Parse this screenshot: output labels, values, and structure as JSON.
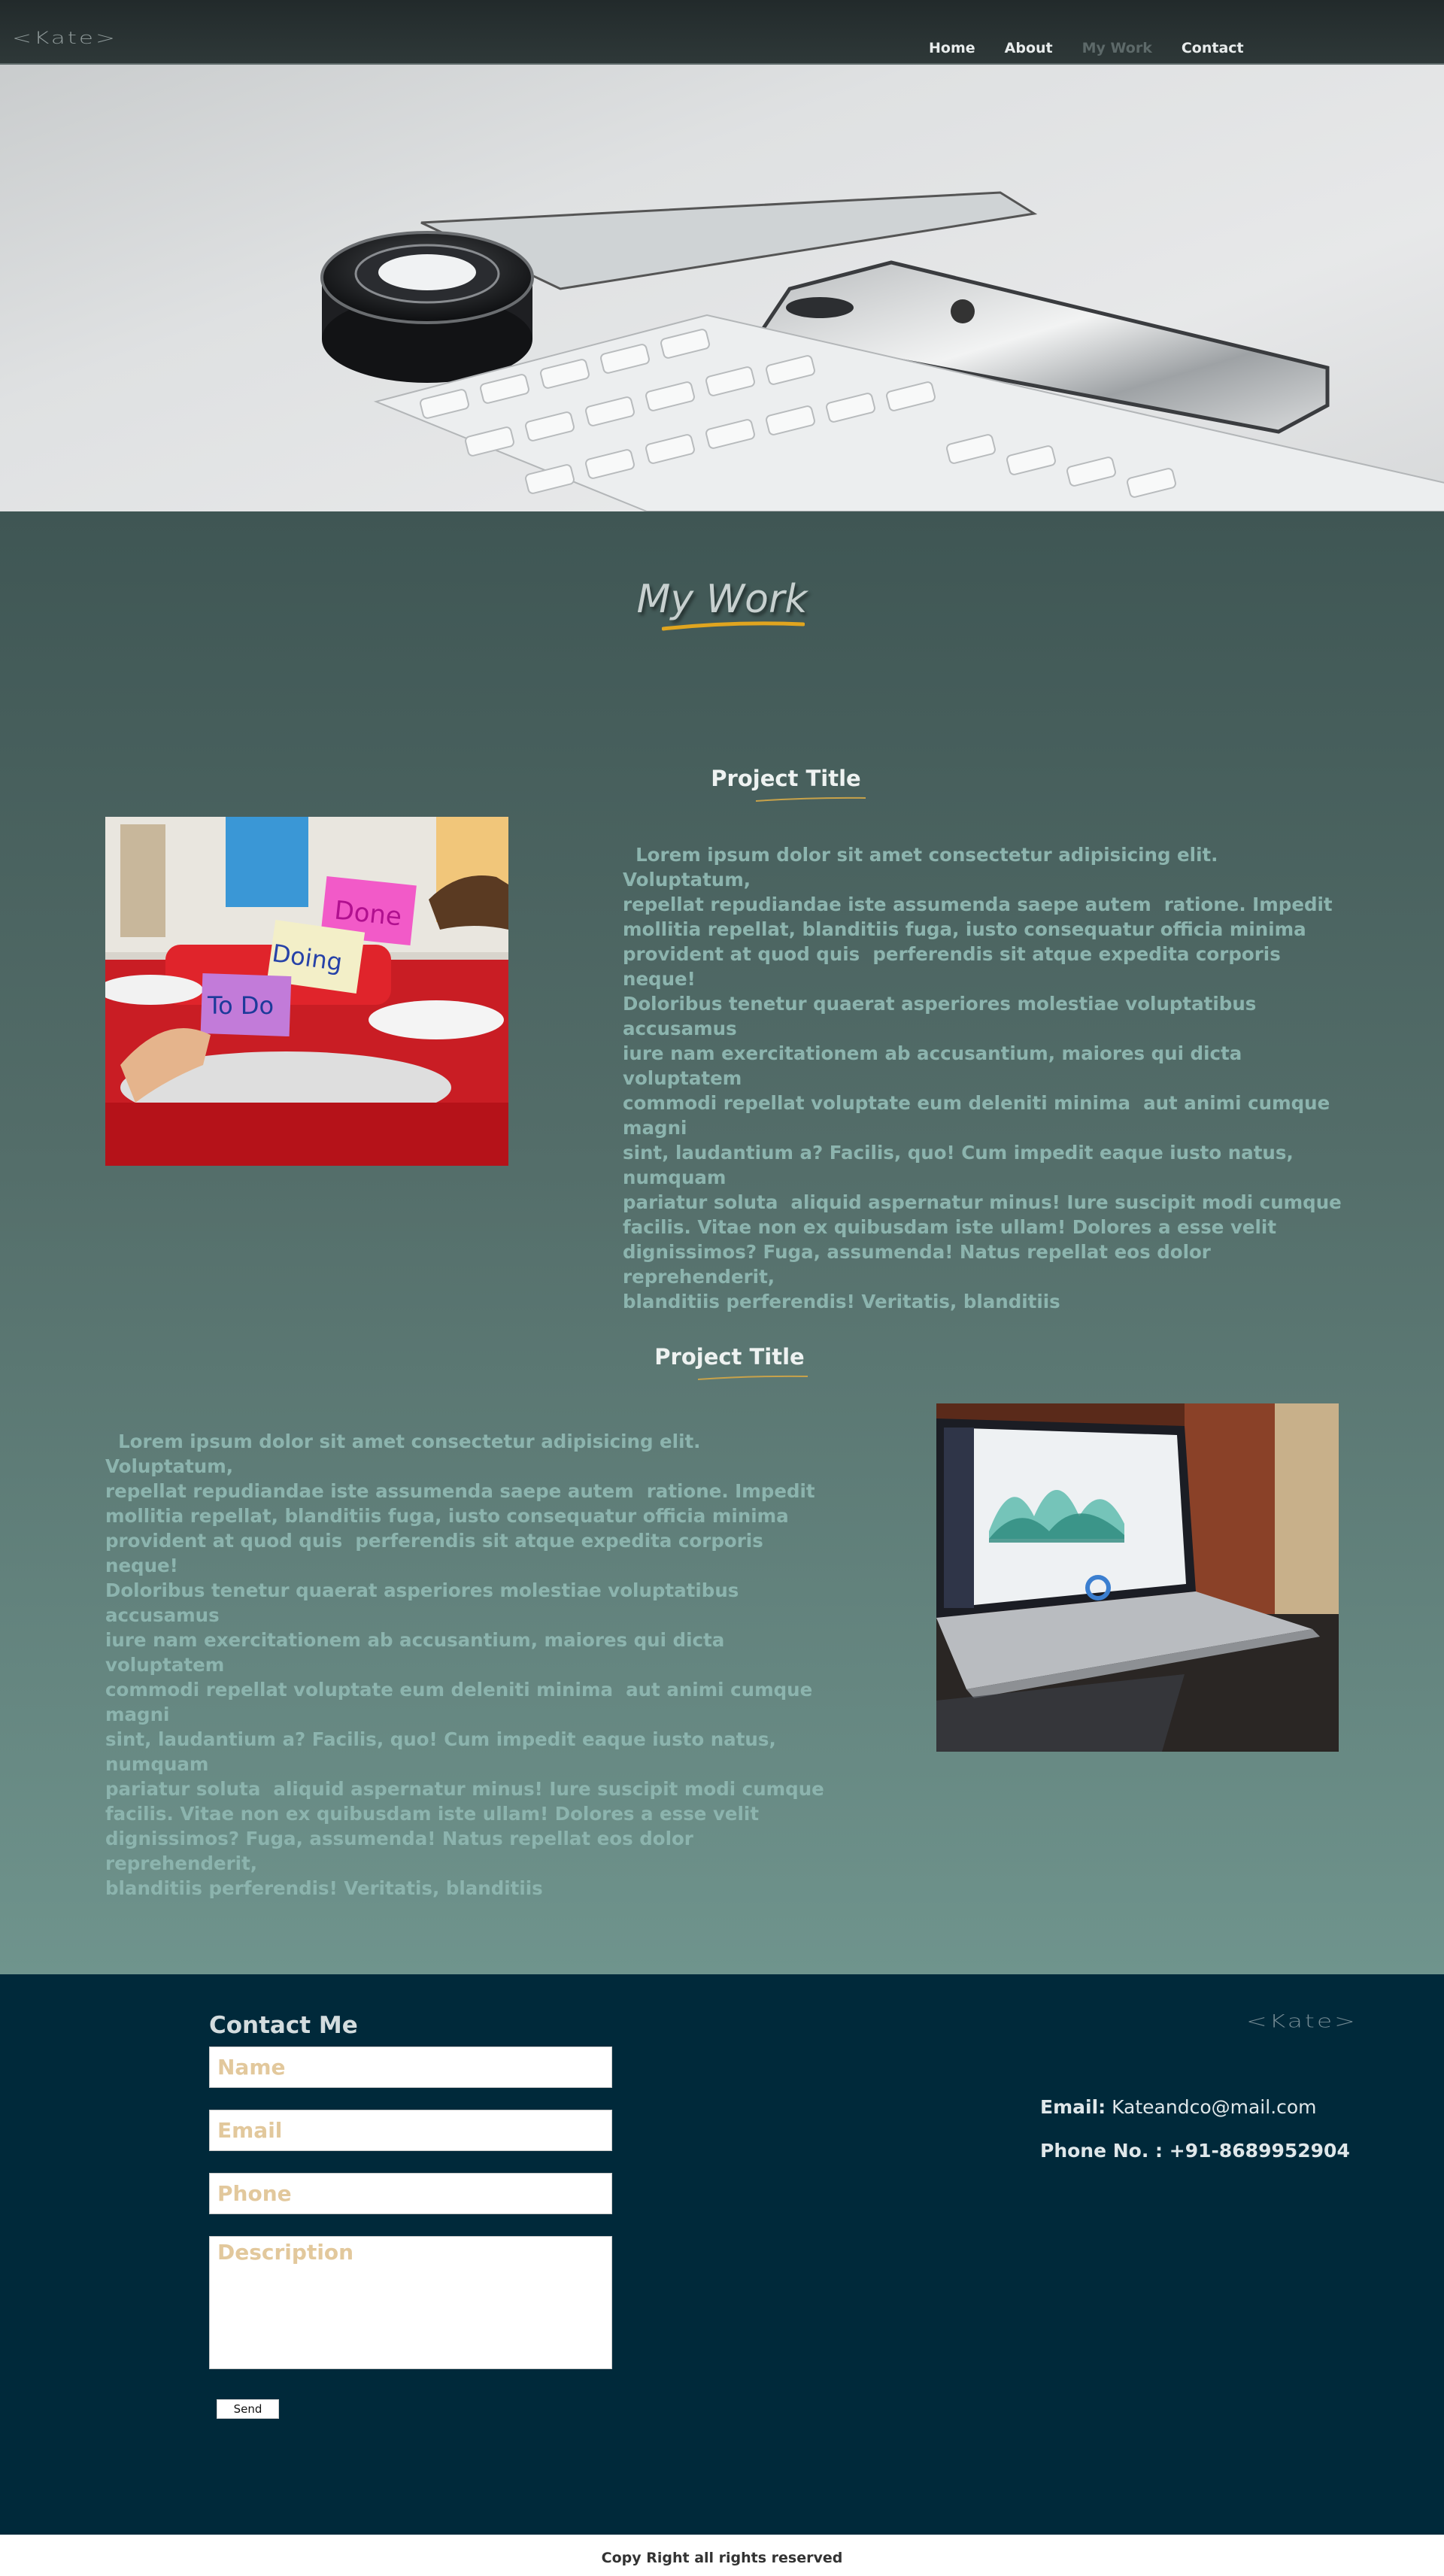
{
  "brand": {
    "logo_text": "<Kate>"
  },
  "nav": {
    "items": [
      {
        "label": "Home",
        "active": false
      },
      {
        "label": "About",
        "active": false
      },
      {
        "label": "My Work",
        "active": true
      },
      {
        "label": "Contact",
        "active": false
      }
    ]
  },
  "work": {
    "heading": "My Work",
    "projects": [
      {
        "title": "Project Title",
        "image": "sticky-notes-todo-doing-done",
        "image_notes": [
          "Done",
          "Doing",
          "To Do"
        ],
        "body": "  Lorem ipsum dolor sit amet consectetur adipisicing elit. Voluptatum,\nrepellat repudiandae iste assumenda saepe autem  ratione. Impedit\nmollitia repellat, blanditiis fuga, iusto consequatur officia minima\nprovident at quod quis  perferendis sit atque expedita corporis neque!\nDoloribus tenetur quaerat asperiores molestiae voluptatibus accusamus\niure nam exercitationem ab accusantium, maiores qui dicta voluptatem\ncommodi repellat voluptate eum deleniti minima  aut animi cumque magni\nsint, laudantium a? Facilis, quo! Cum impedit eaque iusto natus, numquam\npariatur soluta  aliquid aspernatur minus! Iure suscipit modi cumque\nfacilis. Vitae non ex quibusdam iste ullam! Dolores a esse velit\ndignissimos? Fuga, assumenda! Natus repellat eos dolor reprehenderit,\nblanditiis perferendis! Veritatis, blanditiis"
      },
      {
        "title": "Project Title",
        "image": "laptop-dashboard",
        "body": "  Lorem ipsum dolor sit amet consectetur adipisicing elit. Voluptatum,\nrepellat repudiandae iste assumenda saepe autem  ratione. Impedit\nmollitia repellat, blanditiis fuga, iusto consequatur officia minima\nprovident at quod quis  perferendis sit atque expedita corporis neque!\nDoloribus tenetur quaerat asperiores molestiae voluptatibus accusamus\niure nam exercitationem ab accusantium, maiores qui dicta voluptatem\ncommodi repellat voluptate eum deleniti minima  aut animi cumque magni\nsint, laudantium a? Facilis, quo! Cum impedit eaque iusto natus, numquam\npariatur soluta  aliquid aspernatur minus! Iure suscipit modi cumque\nfacilis. Vitae non ex quibusdam iste ullam! Dolores a esse velit\ndignissimos? Fuga, assumenda! Natus repellat eos dolor reprehenderit,\nblanditiis perferendis! Veritatis, blanditiis"
      }
    ]
  },
  "contact": {
    "heading": "Contact Me",
    "form": {
      "name_placeholder": "Name",
      "email_placeholder": "Email",
      "phone_placeholder": "Phone",
      "description_placeholder": "Description",
      "send_label": "Send"
    },
    "logo_text": "<Kate>",
    "email_label": "Email:",
    "email_value": "Kateandco@mail.com",
    "phone_label": "Phone No. :",
    "phone_value": "+91-8689952904"
  },
  "footer": {
    "copyright": "Copy Right all rights reserved"
  },
  "colors": {
    "nav_bg": "#222a2b",
    "work_bg_top": "#3f5654",
    "work_bg_bottom": "#6f948d",
    "accent_underline": "#e0a51f",
    "contact_bg": "#00293a",
    "body_text": "#8cb4ae",
    "placeholder": "#e2c89c"
  }
}
